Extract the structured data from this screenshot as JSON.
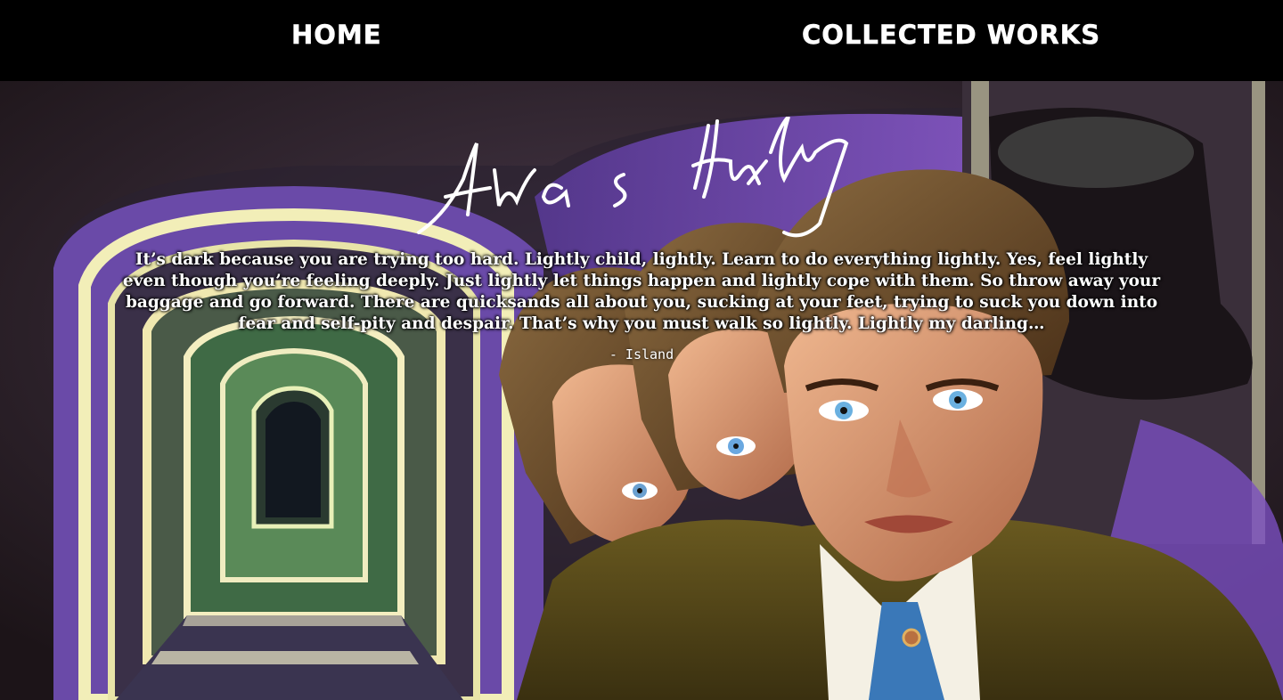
{
  "nav": {
    "home_label": "HOME",
    "works_label": "COLLECTED WORKS"
  },
  "hero": {
    "signature": "Aldous Huxley",
    "quote": "It’s dark because you are trying too hard. Lightly child, lightly. Learn to do everything lightly. Yes, feel lightly even though you’re feeling deeply. Just lightly let things happen and lightly cope with them. So throw away your baggage and go forward. There are quicksands all about you, sucking at your feet, trying to suck you down into fear and self-pity and despair. That’s why you must walk so lightly. Lightly my darling…",
    "source": "- Island"
  },
  "colors": {
    "nav_bg": "#000000",
    "nav_text": "#ffffff",
    "painting_purple": "#7a4fc0",
    "painting_green": "#6f9a5a"
  }
}
